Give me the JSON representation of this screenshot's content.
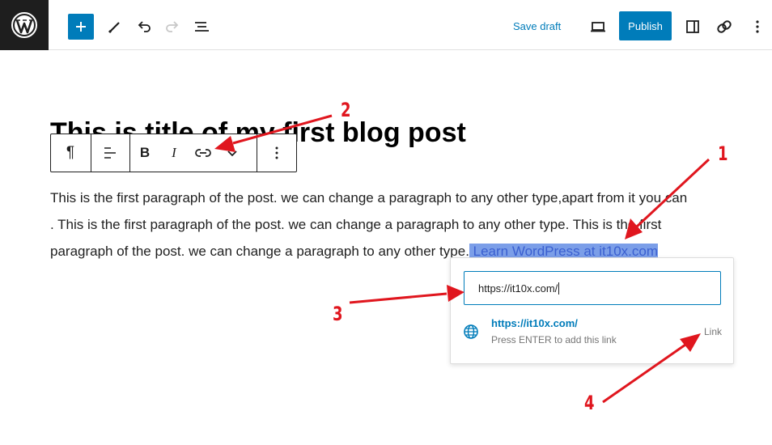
{
  "toolbar": {
    "save_draft_label": "Save draft",
    "publish_label": "Publish"
  },
  "post": {
    "title": "This is title of my first blog post",
    "paragraph_lines": [
      "This is the first paragraph of the post. we can change a paragraph to any other type,apart from it you can",
      ". This is the first paragraph of the post. we can change a paragraph to any other type. This is the first",
      "paragraph of the post. we can change a paragraph to any other type."
    ],
    "selected_link_text": " Learn WordPress at it10x.com"
  },
  "block_toolbar": {
    "paragraph_glyph": "¶",
    "bold_label": "B",
    "italic_label": "I"
  },
  "link_popover": {
    "input_value": "https://it10x.com/",
    "suggestion_url": "https://it10x.com/",
    "suggestion_hint": "Press ENTER to add this link",
    "suggestion_type": "Link"
  },
  "annotations": {
    "n1": "1",
    "n2": "2",
    "n3": "3",
    "n4": "4",
    "color": "#e0161e"
  },
  "colors": {
    "accent": "#007cba",
    "selection": "#7b9ee8",
    "dark": "#1e1e1e"
  }
}
